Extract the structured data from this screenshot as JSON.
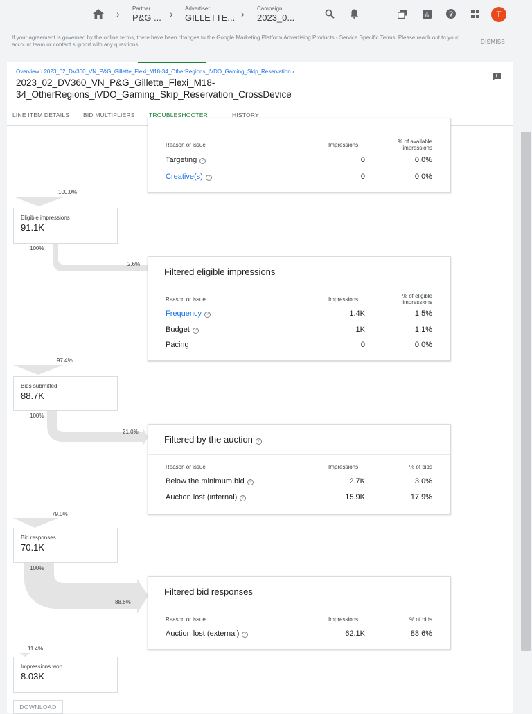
{
  "topbar": {
    "breadcrumbs": [
      {
        "label": "Partner",
        "value": "P&G ..."
      },
      {
        "label": "Advertiser",
        "value": "GILLETTE..."
      },
      {
        "label": "Campaign",
        "value": "2023_0..."
      }
    ],
    "avatar_letter": "T",
    "avatar_color": "#e8491d"
  },
  "notice": {
    "text": "If your agreement is governed by the online terms, there have been changes to the Google Marketing Platform Advertising Products - Service Specific Terms. Please reach out to your account team or contact support with any questions.",
    "dismiss_label": "DISMISS"
  },
  "header": {
    "breadcrumb_overview": "Overview",
    "breadcrumb_campaign": "2023_02_DV360_VN_P&G_Gillette_Flexi_M18-34_OtherRegions_iVDO_Gaming_Skip_Reservation",
    "title": "2023_02_DV360_VN_P&G_Gillette_Flexi_M18-34_OtherRegions_iVDO_Gaming_Skip_Reservation_CrossDevice"
  },
  "tabs": [
    "LINE ITEM DETAILS",
    "BID MULTIPLIERS",
    "TROUBLESHOOTER",
    "HISTORY"
  ],
  "active_tab": "TROUBLESHOOTER",
  "accent_color": "#188038",
  "link_color": "#1a73e8",
  "funnel": {
    "cards": [
      {
        "title": "",
        "headers": [
          "Reason or issue",
          "Impressions",
          "% of available impressions"
        ],
        "rows": [
          {
            "label": "Targeting",
            "impressions": "0",
            "pct": "0.0%"
          },
          {
            "label": "Creative(s)",
            "impressions": "0",
            "pct": "0.0%"
          }
        ]
      },
      {
        "title": "Filtered eligible impressions",
        "headers": [
          "Reason or issue",
          "Impressions",
          "% of eligible impressions"
        ],
        "rows": [
          {
            "label": "Frequency",
            "impressions": "1.4K",
            "pct": "1.5%"
          },
          {
            "label": "Budget",
            "impressions": "1K",
            "pct": "1.1%"
          },
          {
            "label": "Pacing",
            "impressions": "0",
            "pct": "0.0%"
          }
        ]
      },
      {
        "title": "Filtered by the auction",
        "headers": [
          "Reason or issue",
          "Impressions",
          "% of bids"
        ],
        "rows": [
          {
            "label": "Below the minimum bid",
            "impressions": "2.7K",
            "pct": "3.0%"
          },
          {
            "label": "Auction lost (internal)",
            "impressions": "15.9K",
            "pct": "17.9%"
          }
        ]
      },
      {
        "title": "Filtered bid responses",
        "headers": [
          "Reason or issue",
          "Impressions",
          "% of bids"
        ],
        "rows": [
          {
            "label": "Auction lost (external)",
            "impressions": "62.1K",
            "pct": "88.6%"
          }
        ]
      }
    ],
    "stages": [
      {
        "label": "Eligible impressions",
        "value": "91.1K",
        "in_pct": "100.0%",
        "base_pct": "100%",
        "out_pct": "2.6%"
      },
      {
        "label": "Bids submitted",
        "value": "88.7K",
        "in_pct": "97.4%",
        "base_pct": "100%",
        "out_pct": "21.0%"
      },
      {
        "label": "Bid responses",
        "value": "70.1K",
        "in_pct": "79.0%",
        "base_pct": "100%",
        "out_pct": "88.6%"
      },
      {
        "label": "Impressions won",
        "value": "8.03K",
        "in_pct": "11.4%"
      }
    ],
    "download_label": "DOWNLOAD"
  }
}
